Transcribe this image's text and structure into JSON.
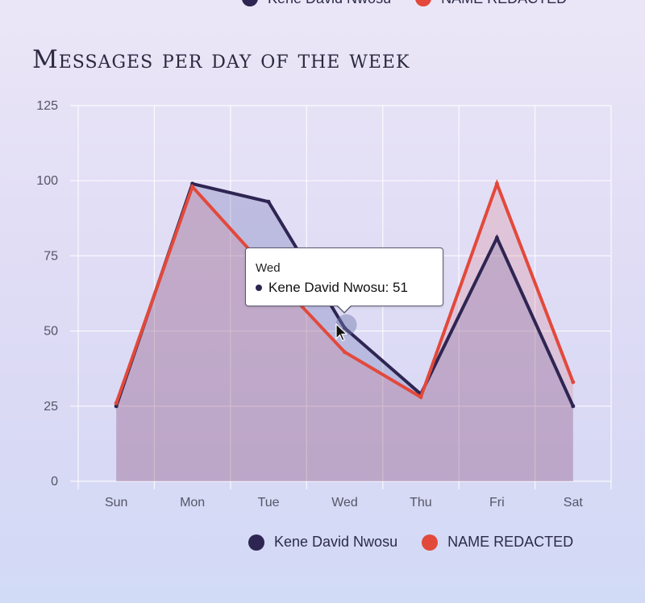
{
  "legend": [
    {
      "name": "Kene David Nwosu",
      "color": "#2e2552"
    },
    {
      "name": "NAME REDACTED",
      "color": "#e2493b"
    }
  ],
  "tooltip": {
    "title": "Wed",
    "label": "Kene David Nwosu: 51"
  },
  "chart_data": {
    "type": "area",
    "title": "Messages per day of the week",
    "xlabel": "",
    "ylabel": "",
    "categories": [
      "Sun",
      "Mon",
      "Tue",
      "Wed",
      "Thu",
      "Fri",
      "Sat"
    ],
    "ylim": [
      0,
      125
    ],
    "yticks": [
      0,
      25,
      50,
      75,
      100,
      125
    ],
    "grid": true,
    "legend_position": "bottom",
    "series": [
      {
        "name": "Kene David Nwosu",
        "color": "#2e2552",
        "fill": "rgba(60,70,150,0.22)",
        "values": [
          25,
          99,
          93,
          51,
          29,
          81,
          25
        ]
      },
      {
        "name": "NAME REDACTED",
        "color": "#e2493b",
        "fill": "rgba(220,110,120,0.22)",
        "values": [
          26,
          98,
          70,
          43,
          28,
          99,
          33
        ]
      }
    ]
  }
}
